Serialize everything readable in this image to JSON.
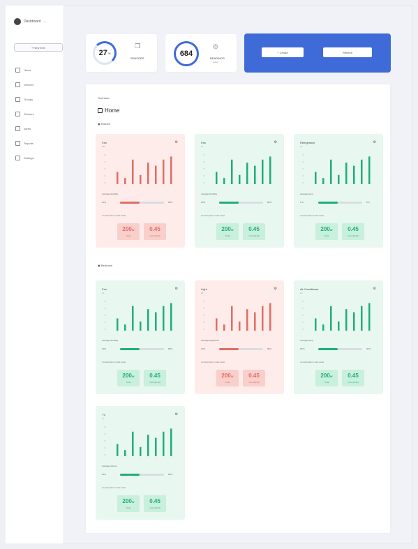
{
  "app": {
    "user_name": "Dashboard",
    "sidebar_button": "+ New item",
    "nav": [
      {
        "label": "Home",
        "icon": "home-icon"
      },
      {
        "label": "Devices",
        "icon": "devices-icon"
      },
      {
        "label": "Groups",
        "icon": "groups-icon"
      },
      {
        "label": "Sensors",
        "icon": "sensors-icon"
      },
      {
        "label": "Alerts",
        "icon": "alert-icon"
      },
      {
        "label": "Reports",
        "icon": "report-icon"
      },
      {
        "label": "Settings",
        "icon": "settings-icon"
      }
    ]
  },
  "stats": [
    {
      "value": "27",
      "unit": "%",
      "label": "SENSORS",
      "sub": ""
    },
    {
      "value": "684",
      "unit": "",
      "label": "READINGS",
      "sub": "today"
    }
  ],
  "actions": {
    "primary": "+ Create",
    "secondary": "Refresh"
  },
  "main": {
    "section": "Overview",
    "title": "Home",
    "groups": [
      "Kitchen",
      "Bedroom"
    ]
  },
  "colors": {
    "accent": "#3f6bd9",
    "good": "#1fae79",
    "bad": "#e06d64"
  },
  "cards": [
    {
      "name": "Fan",
      "sub": "idle",
      "status": "red",
      "metric": "Average humidity",
      "low": "20%",
      "high": "80%",
      "fill": 0.45,
      "desc": "Consumption in last week",
      "v1": "200",
      "u1": "W",
      "c1": "Total",
      "v2": "0.45",
      "u2": "",
      "c2": "Cost (EUR)",
      "bars": [
        4,
        2,
        8,
        3,
        7,
        6,
        8,
        9
      ]
    },
    {
      "name": "Fan",
      "sub": "on",
      "status": "green",
      "metric": "Average humidity",
      "low": "20%",
      "high": "80%",
      "fill": 0.45,
      "desc": "Consumption in last week",
      "v1": "200",
      "u1": "W",
      "c1": "Total",
      "v2": "0.45",
      "u2": "",
      "c2": "Cost (EUR)",
      "bars": [
        4,
        2,
        8,
        3,
        7,
        6,
        8,
        9
      ]
    },
    {
      "name": "Refrigerator",
      "sub": "on",
      "status": "green",
      "metric": "Average temp",
      "low": "2°C",
      "high": "8°C",
      "fill": 0.45,
      "desc": "Consumption in last week",
      "v1": "200",
      "u1": "W",
      "c1": "Total",
      "v2": "0.45",
      "u2": "",
      "c2": "Cost (EUR)",
      "bars": [
        4,
        2,
        8,
        3,
        7,
        6,
        8,
        9
      ]
    },
    {
      "name": "Fan",
      "sub": "on",
      "status": "green",
      "metric": "Average humidity",
      "low": "20%",
      "high": "80%",
      "fill": 0.45,
      "desc": "Consumption in last week",
      "v1": "200",
      "u1": "W",
      "c1": "Total",
      "v2": "0.45",
      "u2": "",
      "c2": "Cost (EUR)",
      "bars": [
        4,
        2,
        8,
        3,
        7,
        6,
        8,
        9
      ]
    },
    {
      "name": "Light",
      "sub": "off",
      "status": "red",
      "metric": "Average brightness",
      "low": "20%",
      "high": "80%",
      "fill": 0.45,
      "desc": "Consumption in last week",
      "v1": "200",
      "u1": "W",
      "c1": "Total",
      "v2": "0.45",
      "u2": "",
      "c2": "Cost (EUR)",
      "bars": [
        4,
        2,
        8,
        3,
        7,
        6,
        8,
        9
      ]
    },
    {
      "name": "Air Conditioner",
      "sub": "on",
      "status": "green",
      "metric": "Average temp",
      "low": "18°C",
      "high": "30°C",
      "fill": 0.45,
      "desc": "Consumption in last week",
      "v1": "200",
      "u1": "W",
      "c1": "Total",
      "v2": "0.45",
      "u2": "",
      "c2": "Cost (EUR)",
      "bars": [
        4,
        2,
        8,
        3,
        7,
        6,
        8,
        9
      ]
    },
    {
      "name": "TV",
      "sub": "on",
      "status": "green",
      "metric": "Average volume",
      "low": "20%",
      "high": "80%",
      "fill": 0.45,
      "desc": "Consumption in last week",
      "v1": "200",
      "u1": "W",
      "c1": "Total",
      "v2": "0.45",
      "u2": "",
      "c2": "Cost (EUR)",
      "bars": [
        4,
        2,
        8,
        3,
        7,
        6,
        8,
        9
      ]
    }
  ]
}
